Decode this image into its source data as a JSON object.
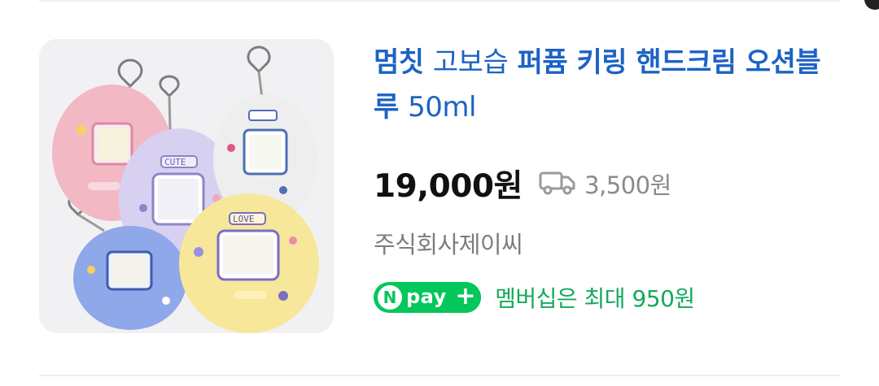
{
  "product": {
    "brand": "멈칫",
    "maker": "고보습",
    "name": "퍼퓸 키링 핸드크림 오션블루",
    "volume": "50ml",
    "price": "19,000원",
    "shipping_fee": "3,500원",
    "seller": "주식회사제이씨",
    "thumbnail_alt": "product-image",
    "thumbnail_texts": [
      "CUTE",
      "LOVE"
    ]
  },
  "npay": {
    "logo_n": "N",
    "logo_word": "pay",
    "logo_plus": "+",
    "benefit": "멤버십은 최대 950원"
  },
  "colors": {
    "title_blue": "#1c63c4",
    "price": "#111111",
    "muted": "#8a8a8a",
    "npay_green": "#03c75a",
    "benefit_green": "#16a95c"
  },
  "icons": {
    "shipping": "truck-icon"
  }
}
